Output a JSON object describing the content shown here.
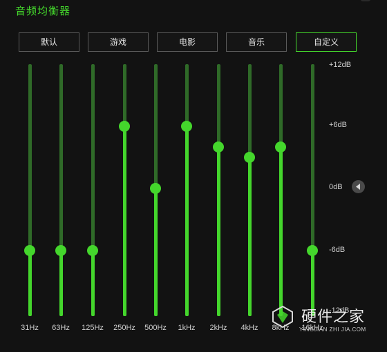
{
  "title": "音频均衡器",
  "presets": [
    {
      "label": "默认",
      "active": false
    },
    {
      "label": "游戏",
      "active": false
    },
    {
      "label": "电影",
      "active": false
    },
    {
      "label": "音乐",
      "active": false
    },
    {
      "label": "自定义",
      "active": true
    }
  ],
  "db_labels": [
    "+12dB",
    "+6dB",
    "0dB",
    "-6dB",
    "-12dB"
  ],
  "db_range": [
    -12,
    12
  ],
  "bands": [
    {
      "freq": "31Hz",
      "gain_db": -6
    },
    {
      "freq": "63Hz",
      "gain_db": -6
    },
    {
      "freq": "125Hz",
      "gain_db": -6
    },
    {
      "freq": "250Hz",
      "gain_db": 6
    },
    {
      "freq": "500Hz",
      "gain_db": 0
    },
    {
      "freq": "1kHz",
      "gain_db": 6
    },
    {
      "freq": "2kHz",
      "gain_db": 4
    },
    {
      "freq": "4kHz",
      "gain_db": 3
    },
    {
      "freq": "8kHz",
      "gain_db": 4
    },
    {
      "freq": "16kHz",
      "gain_db": -6
    }
  ],
  "colors": {
    "accent": "#44d62c",
    "track_dim": "#2f6a28",
    "background": "#121212"
  },
  "watermark": {
    "name": "硬件之家",
    "url": "YINGJIAN ZHI JIA.COM"
  },
  "icons": {
    "reset": "triangle-left-icon",
    "watermark": "watermark-logo-icon"
  }
}
